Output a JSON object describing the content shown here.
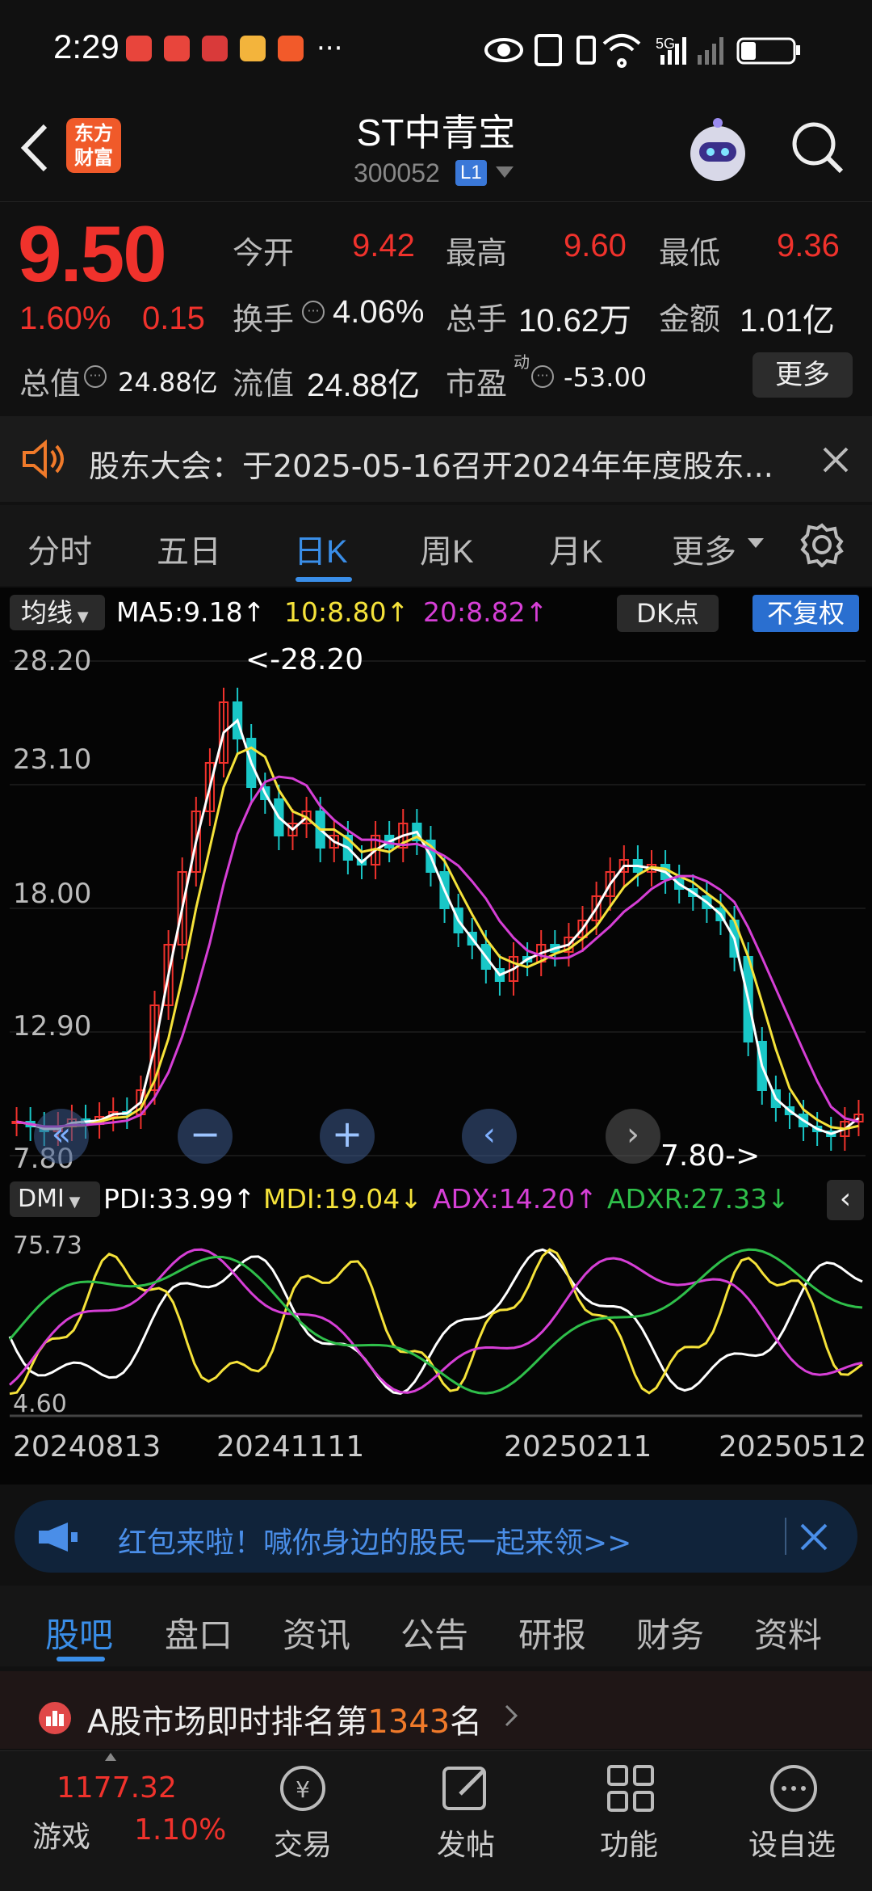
{
  "status": {
    "time": "2:29",
    "dots": "···",
    "network": "5G"
  },
  "header": {
    "title": "ST中青宝",
    "code": "300052",
    "level": "L1"
  },
  "quote": {
    "price": "9.50",
    "change_pct": "1.60%",
    "change": "0.15",
    "open_label": "今开",
    "open": "9.42",
    "high_label": "最高",
    "high": "9.60",
    "low_label": "最低",
    "low": "9.36",
    "turnover_label": "换手",
    "turnover": "4.06%",
    "volume_label": "总手",
    "volume": "10.62万",
    "amount_label": "金额",
    "amount": "1.01亿",
    "mktcap_label": "总值",
    "mktcap": "24.88亿",
    "float_label": "流值",
    "float": "24.88亿",
    "pe_label": "市盈",
    "pe_sup": "动",
    "pe": "-53.00",
    "more": "更多"
  },
  "announcement": {
    "text": "股东大会：于2025-05-16召开2024年年度股东..."
  },
  "chart_tabs": [
    "分时",
    "五日",
    "日K",
    "周K",
    "月K",
    "更多"
  ],
  "chart_tabs_active": 2,
  "kline": {
    "ma_selector": "均线",
    "ma5": "MA5:9.18↑",
    "ma10": "10:8.80↑",
    "ma20": "20:8.82↑",
    "dk": "DK点",
    "fq": "不复权",
    "y_ticks": [
      "28.20",
      "23.10",
      "18.00",
      "12.90",
      "7.80"
    ],
    "max_label": "<-28.20",
    "min_label": "7.80->",
    "colors": {
      "up": "#f0322c",
      "down": "#19c7c7",
      "ma5": "#ffffff",
      "ma10": "#f5e23a",
      "ma20": "#d63fd6"
    }
  },
  "dmi": {
    "selector": "DMI",
    "pdi": "PDI:33.99↑",
    "mdi": "MDI:19.04↓",
    "adx": "ADX:14.20↑",
    "adxr": "ADXR:27.33↓",
    "y_top": "75.73",
    "y_bottom": "4.60",
    "x_labels": [
      "20240813",
      "20241111",
      "20250211",
      "20250512"
    ]
  },
  "bubble": {
    "text": "红包来啦！喊你身边的股民一起来领>>"
  },
  "bottom_tabs": [
    "股吧",
    "盘口",
    "资讯",
    "公告",
    "研报",
    "财务",
    "资料"
  ],
  "bottom_tabs_active": 0,
  "rank": {
    "prefix": "A股市场即时排名第",
    "num": "1343",
    "suffix": "名"
  },
  "nav": {
    "index_value": "1177.32",
    "index_name": "游戏",
    "index_pct": "1.10%",
    "items": [
      "交易",
      "发帖",
      "功能",
      "设自选"
    ]
  },
  "chart_data": {
    "type": "candlestick",
    "y_range": [
      7.8,
      28.2
    ],
    "y_ticks": [
      28.2,
      23.1,
      18.0,
      12.9,
      7.8
    ],
    "x_labels": [
      "20240813",
      "20241111",
      "20250211",
      "20250512"
    ],
    "close_trend": [
      9.2,
      9.0,
      8.8,
      9.0,
      9.3,
      9.1,
      9.4,
      9.6,
      9.5,
      10.5,
      14.0,
      16.5,
      19.5,
      22.0,
      24.0,
      26.5,
      25.0,
      23.0,
      22.5,
      21.0,
      21.5,
      22.0,
      20.5,
      21.0,
      20.0,
      19.8,
      21.0,
      20.5,
      21.5,
      20.8,
      19.5,
      18.0,
      17.0,
      16.5,
      15.5,
      15.0,
      16.0,
      15.8,
      16.5,
      16.2,
      16.8,
      17.5,
      18.5,
      19.5,
      20.0,
      19.5,
      19.8,
      19.2,
      18.8,
      18.5,
      18.0,
      17.5,
      16.0,
      12.5,
      10.5,
      9.8,
      9.5,
      9.0,
      8.8,
      8.6,
      9.2,
      9.5
    ]
  }
}
